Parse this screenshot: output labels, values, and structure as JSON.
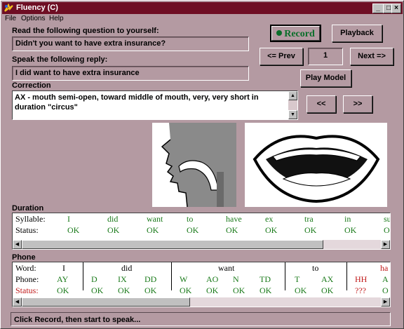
{
  "window": {
    "title": "Fluency (C)"
  },
  "menu": [
    "File",
    "Options",
    "Help"
  ],
  "question": {
    "label": "Read the following question to yourself:",
    "text": "Didn't you want to have extra insurance?"
  },
  "reply": {
    "label": "Speak the following reply:",
    "text": "I did want to have extra insurance"
  },
  "correction": {
    "label": "Correction",
    "text": "AX - mouth semi-open, toward middle of mouth, very, very short in duration  \"circus\""
  },
  "buttons": {
    "record": "Record",
    "playback": "Playback",
    "prev": "<= Prev",
    "page": "1",
    "next": "Next =>",
    "play_model": "Play Model",
    "back": "<<",
    "forward": ">>"
  },
  "duration": {
    "label": "Duration",
    "row_labels": [
      "Syllable:",
      "Status:"
    ],
    "syllables": [
      "I",
      "did",
      "want",
      "to",
      "have",
      "ex",
      "tra",
      "in",
      "su"
    ],
    "statuses": [
      "OK",
      "OK",
      "OK",
      "OK",
      "OK",
      "OK",
      "OK",
      "OK",
      "O"
    ]
  },
  "phone": {
    "label": "Phone",
    "row_labels": [
      "Word:",
      "Phone:",
      "Status:"
    ],
    "words": [
      "I",
      "did",
      "want",
      "to",
      "ha"
    ],
    "phones": [
      "AY",
      "D",
      "IX",
      "DD",
      "W",
      "AO",
      "N",
      "TD",
      "T",
      "AX",
      "HH",
      "A"
    ],
    "statuses": [
      "OK",
      "OK",
      "OK",
      "OK",
      "OK",
      "OK",
      "OK",
      "OK",
      "OK",
      "OK",
      "???",
      "O"
    ]
  },
  "status_bar": "Click Record, then start to speak...",
  "colors": {
    "title_bg": "#6e0e24",
    "face": "#b49aa2",
    "ok": "#1a7a1a",
    "error": "#c01818"
  }
}
